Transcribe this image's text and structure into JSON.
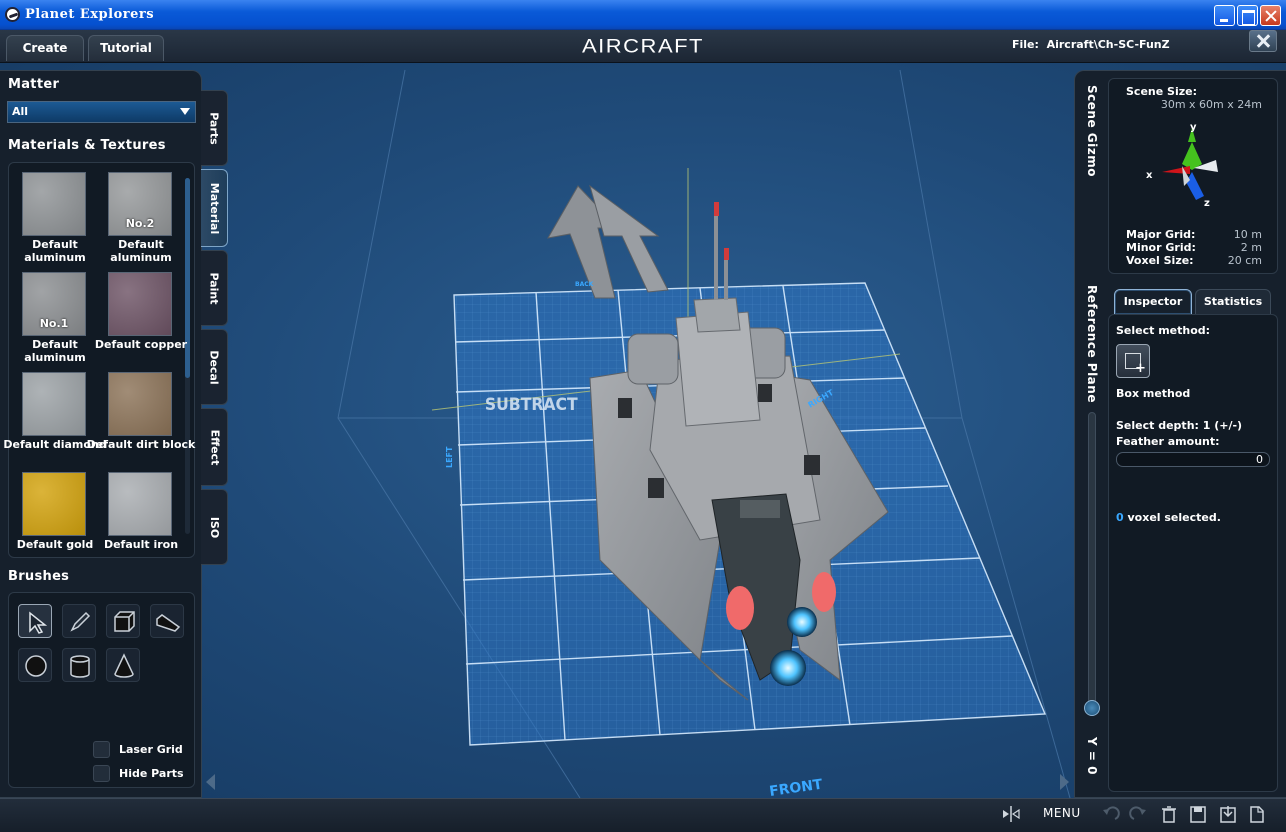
{
  "window": {
    "title": "Planet Explorers"
  },
  "topbar": {
    "tabs": [
      {
        "label": "Create"
      },
      {
        "label": "Tutorial"
      }
    ],
    "mode_title": "AIRCRAFT",
    "file_label": "File:",
    "file_path": "Aircraft\\Ch-SC-FunZ"
  },
  "left": {
    "matter_label": "Matter",
    "matter_selected": "All",
    "materials_label": "Materials & Textures",
    "materials": [
      {
        "name": "Default aluminum",
        "tag": "",
        "color": "#8f9396"
      },
      {
        "name": "Default aluminum",
        "tag": "No.2",
        "color": "#95989a"
      },
      {
        "name": "Default aluminum",
        "tag": "No.1",
        "color": "#8c8f92"
      },
      {
        "name": "Default copper",
        "tag": "",
        "color": "#6e5466"
      },
      {
        "name": "Default diamond",
        "tag": "",
        "color": "#9ca2a6"
      },
      {
        "name": "Default dirt block",
        "tag": "",
        "color": "#8c7358"
      },
      {
        "name": "Default gold",
        "tag": "",
        "color": "#d3a30d"
      },
      {
        "name": "Default iron",
        "tag": "",
        "color": "#a9adb1"
      }
    ],
    "brushes_label": "Brushes",
    "brushes": [
      "select-brush",
      "pencil-brush",
      "box-brush",
      "wedge-brush",
      "sphere-brush",
      "cylinder-brush",
      "cone-brush"
    ],
    "laser_grid": "Laser Grid",
    "hide_parts": "Hide Parts"
  },
  "side_tabs": [
    "Parts",
    "Material",
    "Paint",
    "Decal",
    "Effect",
    "ISO"
  ],
  "viewport": {
    "operation_label": "SUBTRACT",
    "front_label": "FRONT",
    "left_label": "LEFT",
    "right_label": "RIGHT",
    "back_label": "BACK"
  },
  "right": {
    "scene_gizmo_title": "Scene Gizmo",
    "scene_size_label": "Scene Size:",
    "scene_size_value": "30m x 60m x 24m",
    "axes": {
      "x": "x",
      "y": "y",
      "z": "z"
    },
    "major_grid_label": "Major Grid:",
    "major_grid_value": "10 m",
    "minor_grid_label": "Minor Grid:",
    "minor_grid_value": "2 m",
    "voxel_size_label": "Voxel Size:",
    "voxel_size_value": "20 cm",
    "reference_plane_title": "Reference Plane",
    "y_value": "Y = 0",
    "tabs": [
      "Inspector",
      "Statistics"
    ],
    "select_method_label": "Select method:",
    "box_method_label": "Box method",
    "select_depth_label": "Select depth: 1 (+/-)",
    "feather_label": "Feather amount:",
    "feather_value": "0",
    "voxel_count": "0",
    "voxel_selected_label": "voxel selected."
  },
  "bottombar": {
    "menu_label": "MENU"
  },
  "colors": {
    "accent": "#1f6fb4",
    "panel": "#16202c",
    "viewport": "#1f4a78",
    "highlight": "#3aa8ff",
    "gizmo_x": "#d0141a",
    "gizmo_y": "#45c21e",
    "gizmo_z": "#1a5ee6"
  }
}
